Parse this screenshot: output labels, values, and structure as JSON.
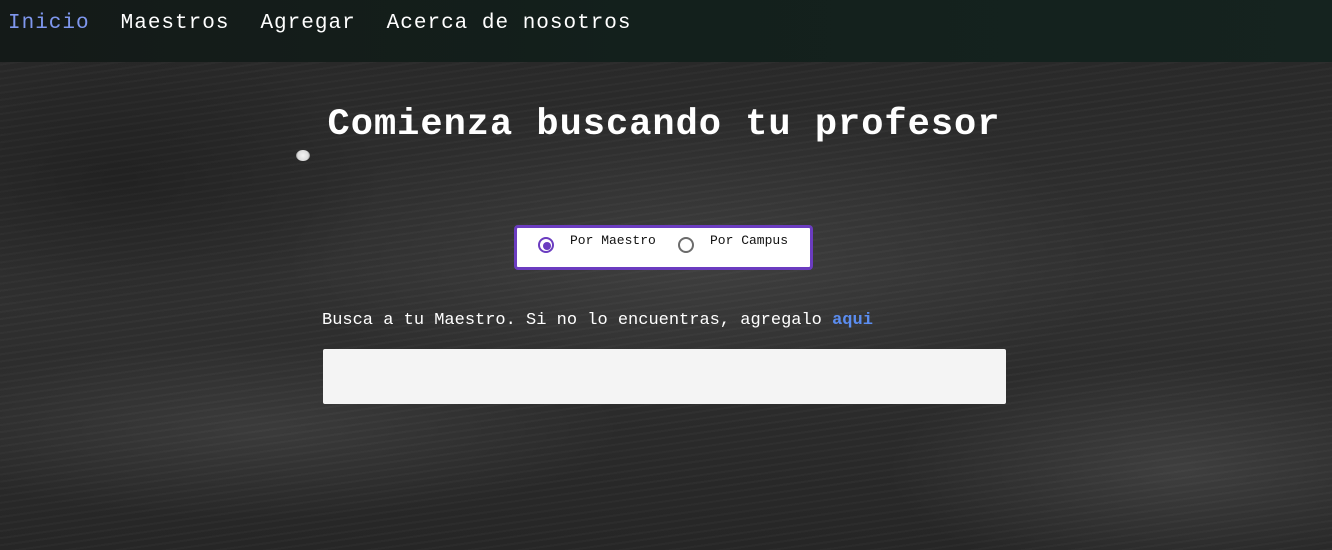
{
  "nav": {
    "items": [
      {
        "label": "Inicio",
        "active": true
      },
      {
        "label": "Maestros",
        "active": false
      },
      {
        "label": "Agregar",
        "active": false
      },
      {
        "label": "Acerca de nosotros",
        "active": false
      }
    ]
  },
  "main": {
    "title": "Comienza buscando tu profesor",
    "search_mode": {
      "options": [
        {
          "label": "Por Maestro",
          "checked": true
        },
        {
          "label": "Por Campus",
          "checked": false
        }
      ]
    },
    "hint_text": "Busca a tu Maestro. Si no lo encuentras, agregalo ",
    "hint_link": "aqui",
    "search_input": {
      "value": "",
      "placeholder": ""
    }
  },
  "colors": {
    "nav_background": "#13201c",
    "nav_active": "#7f97ee",
    "accent_purple": "#6b3cc0",
    "link_blue": "#5b8df0",
    "input_background": "#f4f4f4"
  }
}
